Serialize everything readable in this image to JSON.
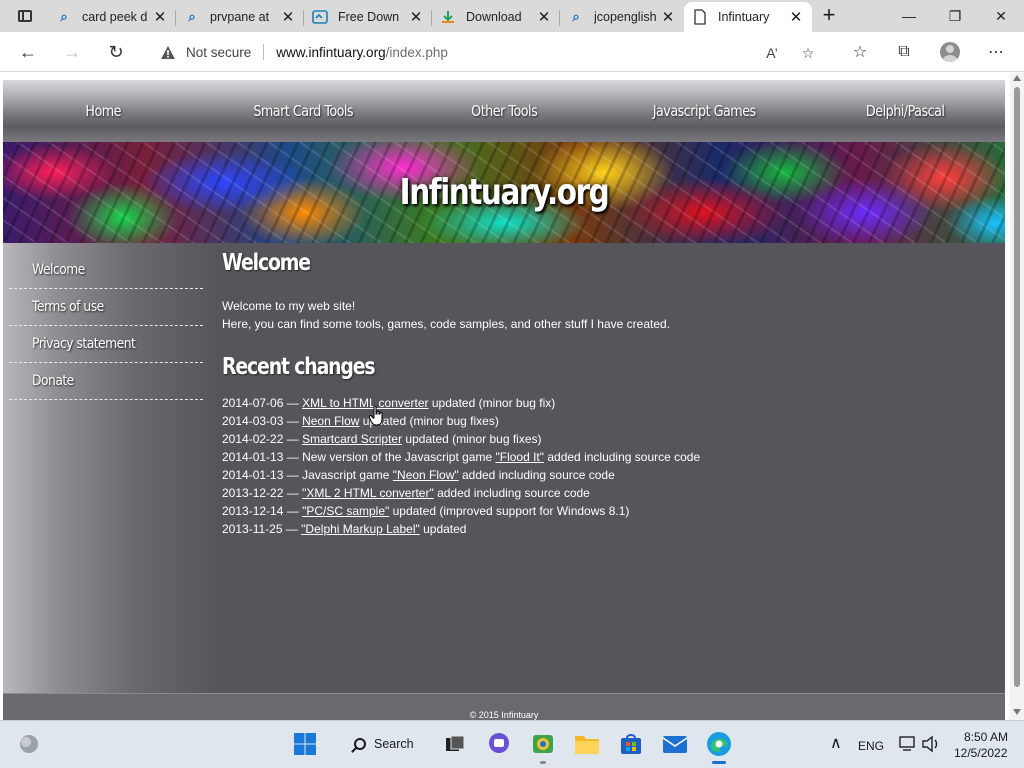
{
  "browser": {
    "tabs": [
      {
        "title": "card peek d",
        "icon": "search-icon",
        "active": false
      },
      {
        "title": "prvpane at",
        "icon": "search-icon",
        "active": false
      },
      {
        "title": "Free Down",
        "icon": "app-icon",
        "active": false
      },
      {
        "title": "Download",
        "icon": "download-icon",
        "active": false
      },
      {
        "title": "jcopenglish",
        "icon": "search-icon",
        "active": false
      },
      {
        "title": "Infintuary",
        "icon": "page-icon",
        "active": true
      }
    ],
    "address": {
      "security_label": "Not secure",
      "url_host": "www.infintuary.org",
      "url_path": "/index.php"
    }
  },
  "site": {
    "nav": [
      "Home",
      "Smart Card Tools",
      "Other Tools",
      "Javascript Games",
      "Delphi/Pascal"
    ],
    "title": "Infintuary.org",
    "sidebar": [
      "Welcome",
      "Terms of use",
      "Privacy statement",
      "Donate"
    ],
    "welcome_heading": "Welcome",
    "welcome_lines": [
      "Welcome to my web site!",
      "Here, you can find some tools, games, code samples, and other stuff I have created."
    ],
    "changes_heading": "Recent changes",
    "changes": [
      {
        "date": "2014-07-06 — ",
        "before": "",
        "link": "XML to HTML converter",
        "after": " updated (minor bug fix)"
      },
      {
        "date": "2014-03-03 — ",
        "before": "",
        "link": "Neon Flow",
        "after": " updated (minor bug fixes)"
      },
      {
        "date": "2014-02-22 — ",
        "before": "",
        "link": "Smartcard Scripter",
        "after": " updated (minor bug fixes)"
      },
      {
        "date": "2014-01-13 — ",
        "before": "New version of the Javascript game ",
        "link": "\"Flood It\"",
        "after": " added including source code"
      },
      {
        "date": "2014-01-13 — ",
        "before": "Javascript game ",
        "link": "\"Neon Flow\"",
        "after": " added including source code"
      },
      {
        "date": "2013-12-22 — ",
        "before": "",
        "link": "\"XML 2 HTML converter\"",
        "after": " added including source code"
      },
      {
        "date": "2013-12-14 — ",
        "before": "",
        "link": "\"PC/SC sample\"",
        "after": " updated (improved support for Windows 8.1)"
      },
      {
        "date": "2013-11-25 — ",
        "before": "",
        "link": "\"Delphi Markup Label\"",
        "after": " updated"
      }
    ],
    "footer": "© 2015 Infintuary"
  },
  "taskbar": {
    "search_label": "Search",
    "language": "ENG",
    "time": "8:50 AM",
    "date": "12/5/2022"
  },
  "colors": {
    "site_background": "#56555b",
    "taskbar": "#dfe6ee",
    "tabstrip": "#dadada"
  }
}
